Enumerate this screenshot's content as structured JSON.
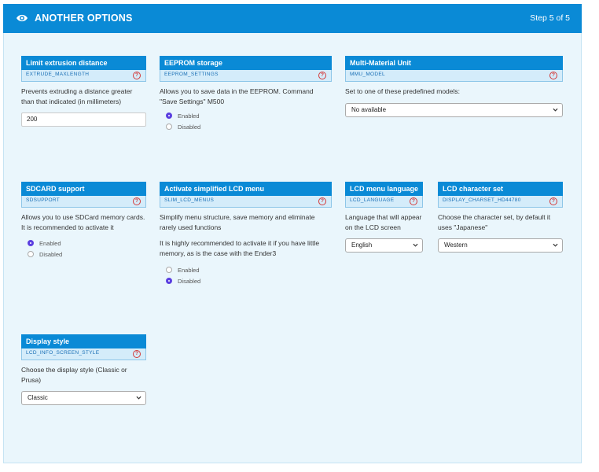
{
  "header": {
    "title": "ANOTHER OPTIONS",
    "step": "Step 5 of 5"
  },
  "cards": {
    "extrusion": {
      "title": "Limit extrusion distance",
      "key": "EXTRUDE_MAXLENGTH",
      "desc": "Prevents extruding a distance greater than that indicated (in millimeters)",
      "value": "200"
    },
    "eeprom": {
      "title": "EEPROM storage",
      "key": "EEPROM_SETTINGS",
      "desc": "Allows you to save data in the EEPROM. Command \"Save Settings\" M500",
      "opt1": "Enabled",
      "opt2": "Disabled"
    },
    "mmu": {
      "title": "Multi-Material Unit",
      "key": "MMU_MODEL",
      "desc": "Set to one of these predefined models:",
      "selected": "No available"
    },
    "sdcard": {
      "title": "SDCARD support",
      "key": "SDSUPPORT",
      "desc": "Allows you to use SDCard memory cards. It is recommended to activate it",
      "opt1": "Enabled",
      "opt2": "Disabled"
    },
    "slim": {
      "title": "Activate simplified LCD menu",
      "key": "SLIM_LCD_MENUS",
      "desc": "Simplify menu structure, save memory and eliminate rarely used functions",
      "desc2": "It is highly recommended to activate it if you have little memory, as is the case with the Ender3",
      "opt1": "Enabled",
      "opt2": "Disabled"
    },
    "language": {
      "title": "LCD menu language",
      "key": "LCD_LANGUAGE",
      "desc": "Language that will appear on the LCD screen",
      "selected": "English"
    },
    "charset": {
      "title": "LCD character set",
      "key": "DISPLAY_CHARSET_HD44780",
      "desc": "Choose the character set, by default it uses \"Japanese\"",
      "selected": "Western"
    },
    "display": {
      "title": "Display style",
      "key": "LCD_INFO_SCREEN_STYLE",
      "desc": "Choose the display style (Classic or Prusa)",
      "selected": "Classic"
    }
  },
  "colors": {
    "header": "#0a8ad6",
    "panel": "#eaf6fc",
    "key_bg": "#d4ecfa",
    "radio_on": "#5b3fe0",
    "help": "#d43a3a"
  },
  "icons": {
    "header": "eye-icon",
    "help": "question-circle-icon",
    "select": "chevron-down-icon"
  }
}
